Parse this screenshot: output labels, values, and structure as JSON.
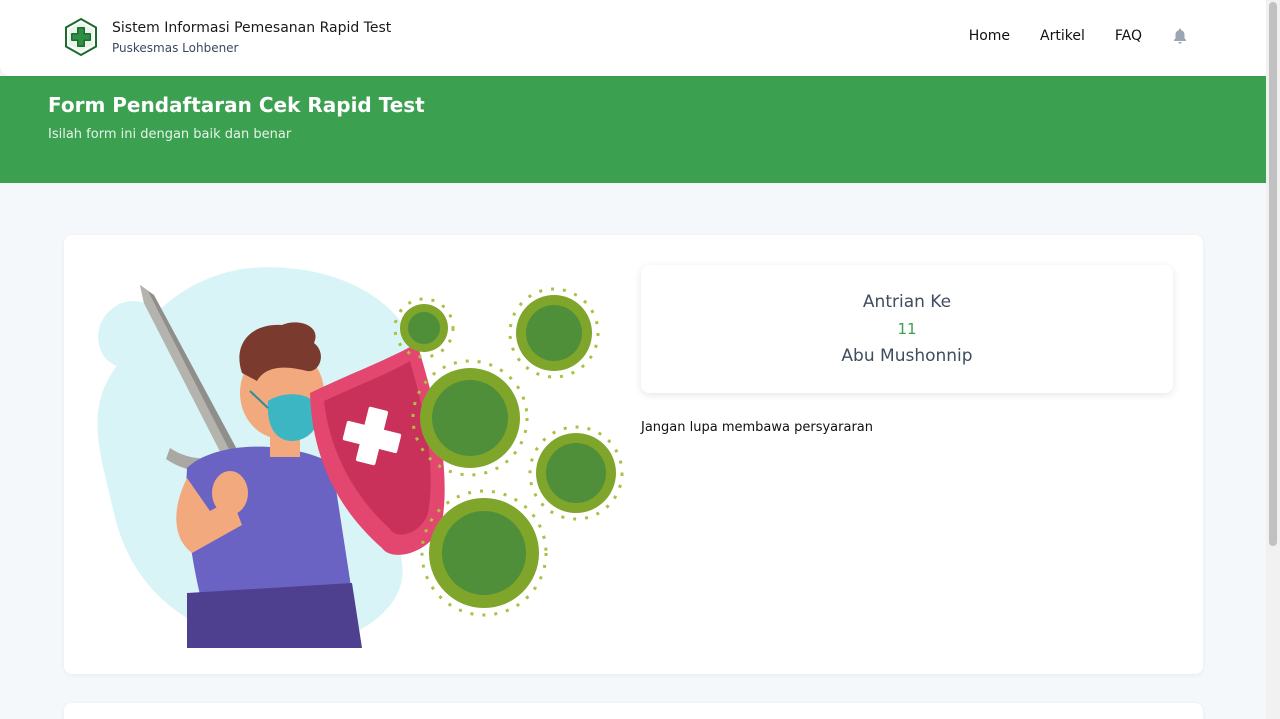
{
  "navbar": {
    "brand_title": "Sistem Informasi Pemesanan Rapid Test",
    "brand_subtitle": "Puskesmas Lohbener",
    "links": [
      {
        "label": "Home"
      },
      {
        "label": "Artikel"
      },
      {
        "label": "FAQ"
      }
    ],
    "notification_icon": "bell-icon"
  },
  "hero": {
    "title": "Form Pendaftaran Cek Rapid Test",
    "subtitle": "Isilah form ini dengan baik dan benar"
  },
  "queue": {
    "label": "Antrian Ke",
    "number": "11",
    "name": "Abu Mushonnip"
  },
  "reminder": "Jangan lupa membawa persyararan",
  "colors": {
    "primary_green": "#3ba150",
    "page_background": "#f4f8fb",
    "text_muted": "#3f4d5f"
  }
}
